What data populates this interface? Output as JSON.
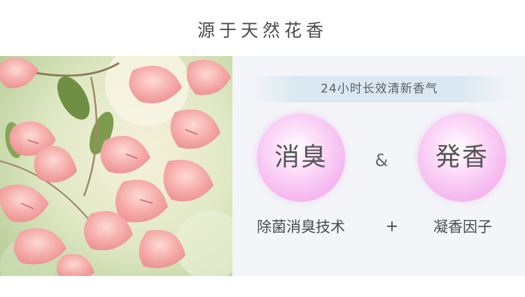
{
  "heading": "源于天然花香",
  "photo": {
    "subject": "bougainvillea-flowers"
  },
  "tagline": "24小时长效清新香气",
  "features": {
    "left_orb": "消臭",
    "right_orb": "発香",
    "ampersand": "&",
    "left_caption": "除菌消臭技术",
    "plus": "+",
    "right_caption": "凝香因子"
  },
  "colors": {
    "orb_pink": "#f5b8ef",
    "tagline_band": "#dbe8f1",
    "panel_bg": "#f3f5f8",
    "flower_pink": "#f29a9c"
  }
}
